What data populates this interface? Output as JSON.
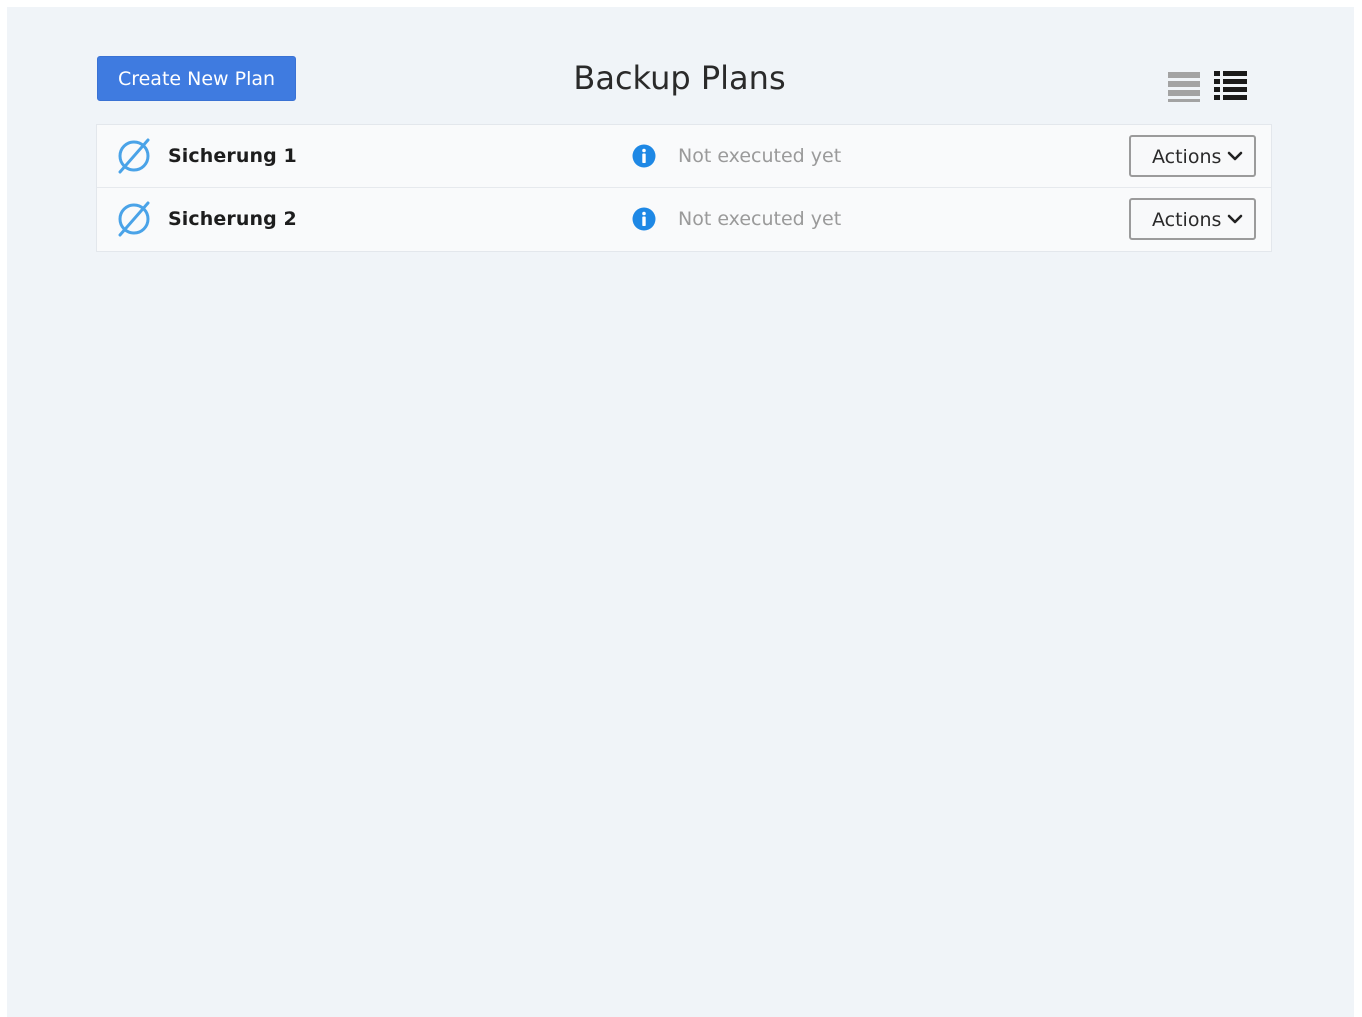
{
  "header": {
    "create_label": "Create New Plan",
    "title": "Backup Plans",
    "views": [
      {
        "icon": "compact-list-icon",
        "active": false
      },
      {
        "icon": "detailed-list-icon",
        "active": true
      }
    ]
  },
  "plans": [
    {
      "name": "Sicherung 1",
      "plan_icon": "empty-set-icon",
      "status_icon": "info-icon",
      "status": "Not executed yet",
      "actions_label": "Actions"
    },
    {
      "name": "Sicherung 2",
      "plan_icon": "empty-set-icon",
      "status_icon": "info-icon",
      "status": "Not executed yet",
      "actions_label": "Actions"
    }
  ],
  "colors": {
    "accent": "#3f7be0",
    "background": "#f0f4f8",
    "icon_blue": "#4aa3e8",
    "info_blue": "#1e88e5",
    "muted_text": "#9a9a9a"
  }
}
